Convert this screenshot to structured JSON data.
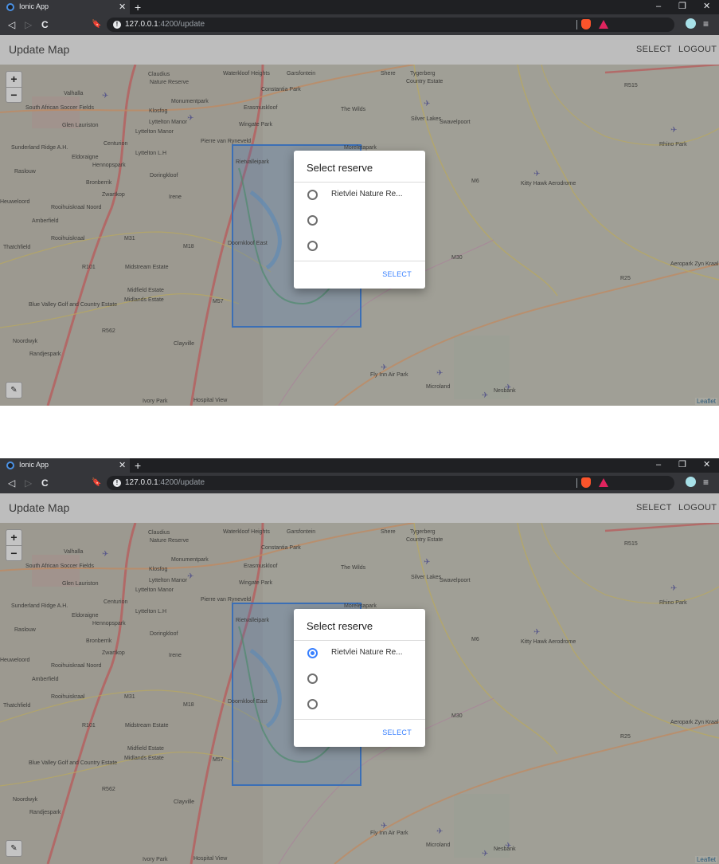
{
  "browser": {
    "tab_title": "Ionic App",
    "tab_close": "✕",
    "new_tab": "+",
    "minimize": "–",
    "restore": "❐",
    "close_window": "✕",
    "back": "◁",
    "forward": "▷",
    "reload": "C",
    "bookmark": "🔖",
    "url_host": "127.0.0.1",
    "url_path": ":4200/update",
    "menu": "≡"
  },
  "header": {
    "title": "Update Map",
    "select_label": "SELECT",
    "logout_label": "LOGOUT"
  },
  "map": {
    "zoom_in": "+",
    "zoom_out": "−",
    "draw_icon": "✎",
    "attribution": "Leaflet",
    "labels": [
      "Claudius",
      "Nature Reserve",
      "Waterkloof Heights",
      "Garsfontein",
      "Shere",
      "Tygerberg",
      "Country Estate",
      "Valhalla",
      "Monumentpark",
      "Constantia Park",
      "South African Soccer Fields",
      "Klosfog",
      "Lyttelton Manor",
      "Erasmuskloof",
      "The Wilds",
      "Silver Lakes",
      "Swavelpoort",
      "Glen Lauriston",
      "Lyttelton Manor",
      "Wingate Park",
      "Centurion",
      "Pierre van Ryneveld",
      "Sunderland Ridge A.H.",
      "Eldoraigne",
      "Lyttelton L.H",
      "Hennopspark",
      "Rietvalleipark",
      "Moreletapark",
      "Raslouw",
      "Doringkloof",
      "Bronberrik",
      "Zwartkop",
      "Irene",
      "M6",
      "Kitty Hawk Aerodrome",
      "Heuweloord",
      "Rooihuiskraal Noord",
      "Amberfield",
      "M31",
      "M18",
      "Doornkloof East",
      "Rooihuiskraal",
      "Thatchfield",
      "R101",
      "Midstream Estate",
      "M30",
      "Midfield Estate",
      "Blue Valley Golf and Country Estate",
      "Midlands Estate",
      "M57",
      "R562",
      "Noordwyk",
      "Clayville",
      "Randjespark",
      "Fly Inn Air Park",
      "Microland",
      "Nesbank",
      "Ivory Park",
      "Hospital View",
      "R515",
      "R25",
      "Aeropark Zyn Kraal",
      "Rhino Park"
    ]
  },
  "frames": [
    {
      "dialog": {
        "title": "Select reserve",
        "options": [
          {
            "label": "Rietvlei Nature Re...",
            "checked": false
          },
          {
            "label": "",
            "checked": false
          },
          {
            "label": "",
            "checked": false
          }
        ],
        "select_label": "SELECT"
      }
    },
    {
      "dialog": {
        "title": "Select reserve",
        "options": [
          {
            "label": "Rietvlei Nature Re...",
            "checked": true
          },
          {
            "label": "",
            "checked": false
          },
          {
            "label": "",
            "checked": false
          }
        ],
        "select_label": "SELECT"
      }
    }
  ],
  "colors": {
    "accent": "#3880ff",
    "header_bg": "#bdbdbd",
    "map_overlay_polygon": "#3b6fb6"
  }
}
